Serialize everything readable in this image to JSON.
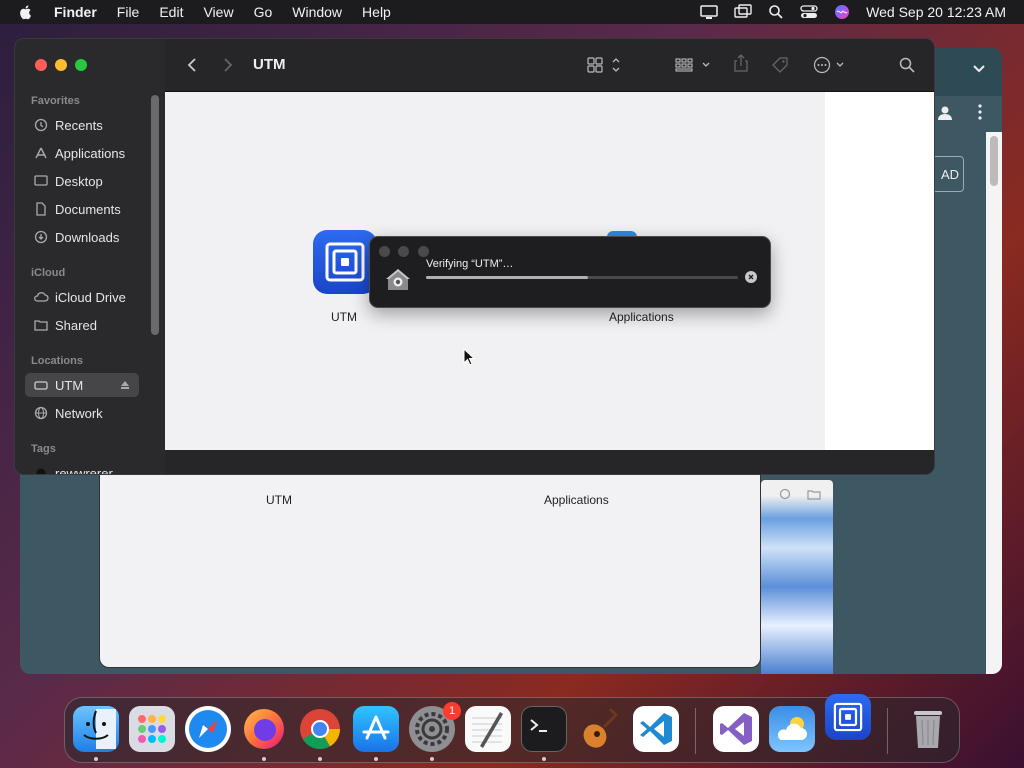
{
  "menubar": {
    "app_name": "Finder",
    "items": [
      "File",
      "Edit",
      "View",
      "Go",
      "Window",
      "Help"
    ],
    "clock": "Wed Sep 20  12:23 AM"
  },
  "background_window": {
    "button_label": "AD"
  },
  "background_finder": {
    "items": [
      "UTM",
      "Applications"
    ]
  },
  "finder": {
    "title": "UTM",
    "sidebar": {
      "favorites_header": "Favorites",
      "favorites": [
        "Recents",
        "Applications",
        "Desktop",
        "Documents",
        "Downloads"
      ],
      "icloud_header": "iCloud",
      "icloud": [
        "iCloud Drive",
        "Shared"
      ],
      "locations_header": "Locations",
      "locations": [
        "UTM",
        "Network"
      ],
      "tags_header": "Tags",
      "tags": [
        "rewwrerer"
      ]
    },
    "files": [
      "UTM",
      "Applications"
    ]
  },
  "verify_dialog": {
    "message": "Verifying “UTM”…",
    "progress": 0.52
  },
  "dock": {
    "apps": [
      "Finder",
      "Launchpad",
      "Safari",
      "Firefox",
      "Chrome",
      "App Store",
      "System Settings",
      "TextEdit",
      "Terminal",
      "GarageBand",
      "Visual Studio Code",
      "Visual Studio",
      "Weather",
      "UTM",
      "Trash"
    ],
    "settings_badge": "1"
  }
}
